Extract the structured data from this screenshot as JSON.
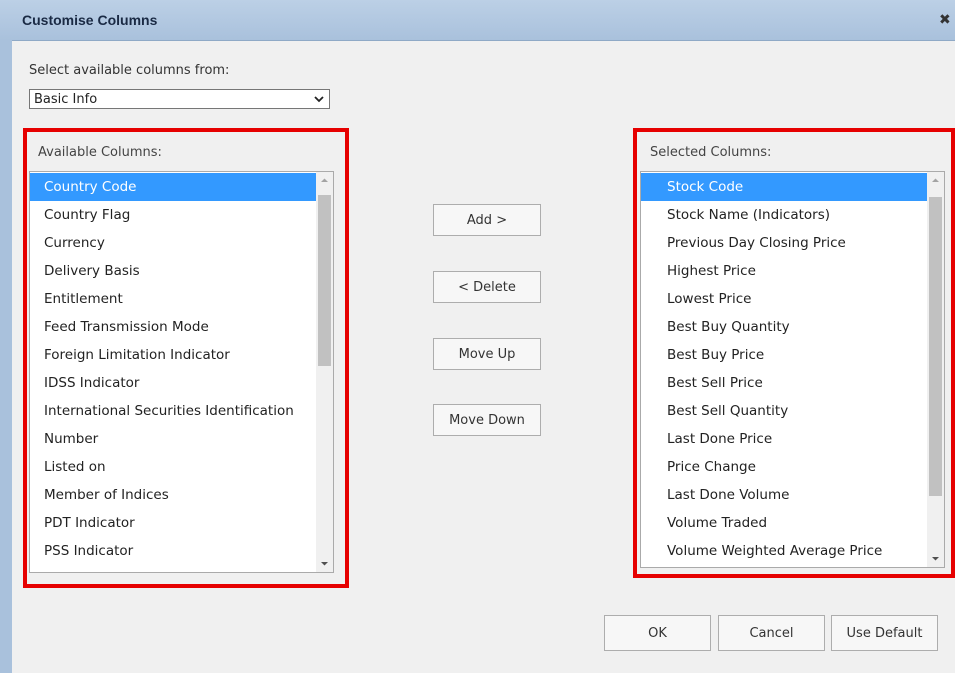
{
  "dialog": {
    "title": "Customise Columns",
    "close_icon": "close-icon"
  },
  "source": {
    "label": "Select available columns from:",
    "selected": "Basic Info"
  },
  "available": {
    "label": "Available Columns:",
    "items": [
      "Country Code",
      "Country Flag",
      "Currency",
      "Delivery Basis",
      "Entitlement",
      "Feed Transmission Mode",
      "Foreign Limitation Indicator",
      "IDSS Indicator",
      "International Securities Identification",
      "Number",
      "Listed on",
      "Member of Indices",
      "PDT Indicator",
      "PSS Indicator"
    ],
    "selected_index": 0
  },
  "selected_columns": {
    "label": "Selected Columns:",
    "items": [
      "Stock Code",
      "Stock Name (Indicators)",
      "Previous Day Closing Price",
      "Highest Price",
      "Lowest Price",
      "Best Buy Quantity",
      "Best Buy Price",
      "Best Sell Price",
      "Best Sell Quantity",
      "Last Done Price",
      "Price Change",
      "Last Done Volume",
      "Volume Traded",
      "Volume Weighted Average Price"
    ],
    "selected_index": 0
  },
  "actions": {
    "add": "Add >",
    "delete": "< Delete",
    "move_up": "Move Up",
    "move_down": "Move Down"
  },
  "footer": {
    "ok": "OK",
    "cancel": "Cancel",
    "use_default": "Use Default"
  },
  "colors": {
    "highlight": "#3399ff",
    "frame": "#e60000",
    "titlebar": "#a9c1dc"
  }
}
